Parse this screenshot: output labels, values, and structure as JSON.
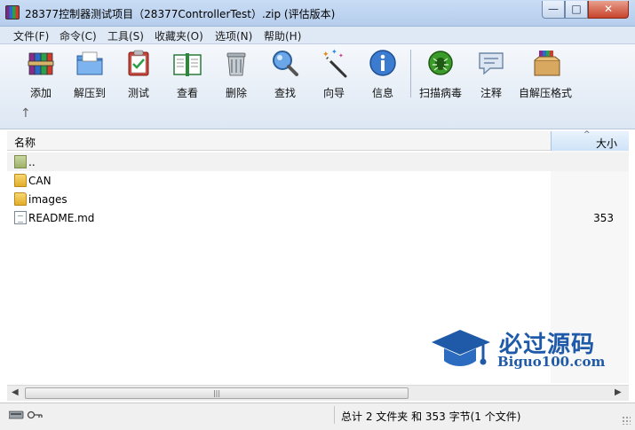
{
  "window": {
    "title": "28377控制器测试项目（28377ControllerTest）.zip (评估版本)",
    "minimize": "—",
    "maximize": "□",
    "close": "✕",
    "icon": "winrar-archive-icon"
  },
  "menu": [
    "文件(F)",
    "命令(C)",
    "工具(S)",
    "收藏夹(O)",
    "选项(N)",
    "帮助(H)"
  ],
  "toolbar": {
    "buttons": [
      {
        "label": "添加",
        "icon": "add-books-icon"
      },
      {
        "label": "解压到",
        "icon": "extract-folder-icon"
      },
      {
        "label": "测试",
        "icon": "test-clipboard-icon"
      },
      {
        "label": "查看",
        "icon": "view-book-icon"
      },
      {
        "label": "删除",
        "icon": "trash-icon"
      },
      {
        "label": "查找",
        "icon": "magnifier-icon"
      },
      {
        "label": "向导",
        "icon": "wizard-wand-icon"
      },
      {
        "label": "信息",
        "icon": "info-icon"
      },
      {
        "label": "扫描病毒",
        "icon": "virus-bug-icon"
      },
      {
        "label": "注释",
        "icon": "comment-icon"
      },
      {
        "label": "自解压格式",
        "icon": "sfx-box-icon"
      }
    ],
    "up_arrow": "↑"
  },
  "columns": {
    "name": "名称",
    "size": "大小",
    "sort_indicator": "^"
  },
  "files": [
    {
      "name": "..",
      "size": "",
      "type": "parent-folder"
    },
    {
      "name": "CAN",
      "size": "",
      "type": "folder"
    },
    {
      "name": "images",
      "size": "",
      "type": "folder"
    },
    {
      "name": "README.md",
      "size": "353",
      "type": "file"
    }
  ],
  "watermark": {
    "cn": "必过源码",
    "en": "Biguo100.com"
  },
  "scrollbar": {
    "left": "◀",
    "right": "▶",
    "grip": "|||"
  },
  "status": {
    "text": "总计 2 文件夹 和 353 字节(1 个文件)"
  },
  "colors": {
    "accent": "#1f5aa8",
    "folder": "#e9b73a",
    "close": "#c7432c"
  }
}
